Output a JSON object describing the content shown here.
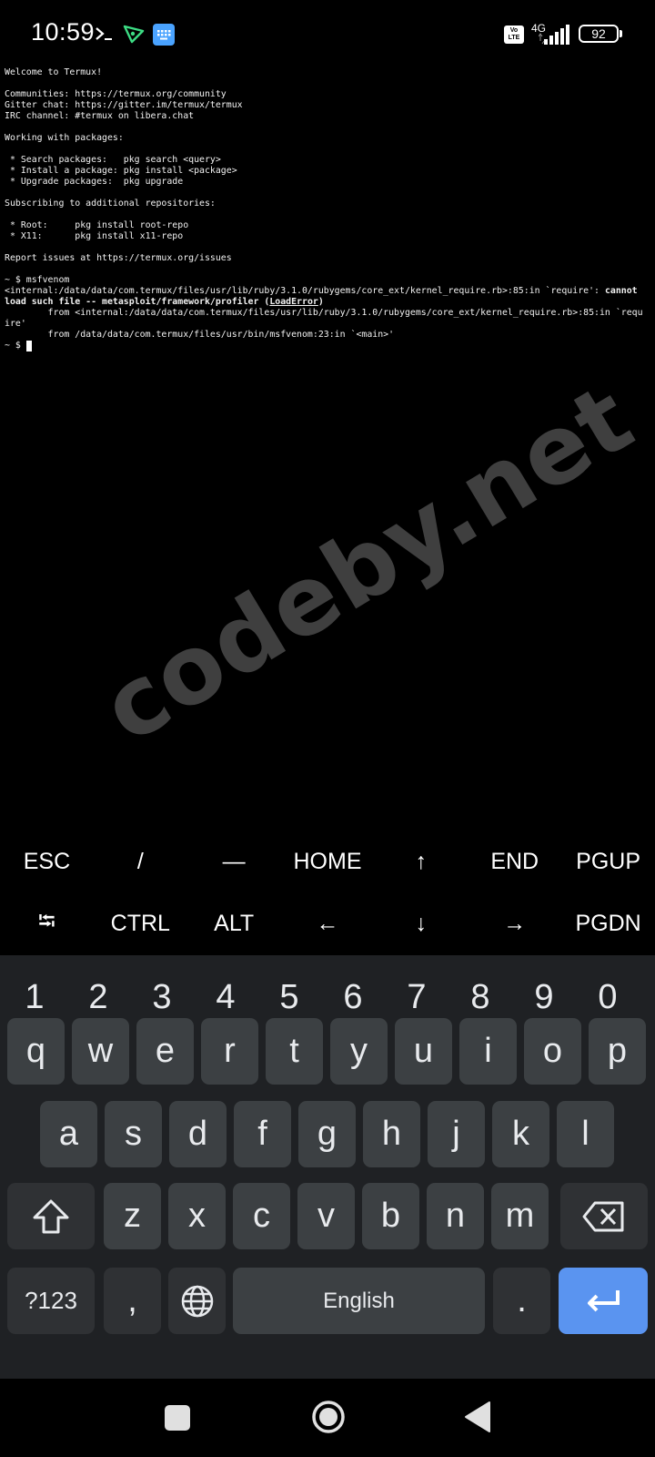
{
  "status_bar": {
    "time": "10:59",
    "prompt_glyph": ">_",
    "volte": "Vo\nLTE",
    "network_type": "4G",
    "battery": "92"
  },
  "terminal": {
    "lines": [
      "Welcome to Termux!",
      "",
      "Communities: https://termux.org/community",
      "Gitter chat: https://gitter.im/termux/termux",
      "IRC channel: #termux on libera.chat",
      "",
      "Working with packages:",
      "",
      " * Search packages:   pkg search <query>",
      " * Install a package: pkg install <package>",
      " * Upgrade packages:  pkg upgrade",
      "",
      "Subscribing to additional repositories:",
      "",
      " * Root:     pkg install root-repo",
      " * X11:      pkg install x11-repo",
      "",
      "Report issues at https://termux.org/issues",
      "",
      "~ $ msfvenom"
    ],
    "error_line_1": "<internal:/data/data/com.termux/files/usr/lib/ruby/3.1.0/rubygems/core_ext/kernel_require.rb>:85:in `require': ",
    "error_bold_1": "cannot",
    "error_bold_2": "load such file -- metasploit/framework/profiler (",
    "error_link": "LoadError",
    "error_bold_3": ")",
    "from_line_1": "        from <internal:/data/data/com.termux/files/usr/lib/ruby/3.1.0/rubygems/core_ext/kernel_require.rb>:85:in `requ",
    "from_line_1b": "ire'",
    "from_line_2": "        from /data/data/com.termux/files/usr/bin/msfvenom:23:in `<main>'",
    "prompt": "~ $ "
  },
  "watermark": "codeby.net",
  "extra_keys": {
    "row1": [
      "ESC",
      "/",
      "—",
      "HOME",
      "↑",
      "END",
      "PGUP"
    ],
    "row2": [
      "⭾",
      "CTRL",
      "ALT",
      "←",
      "↓",
      "→",
      "PGDN"
    ]
  },
  "keyboard": {
    "numbers": [
      "1",
      "2",
      "3",
      "4",
      "5",
      "6",
      "7",
      "8",
      "9",
      "0"
    ],
    "row1": [
      "q",
      "w",
      "e",
      "r",
      "t",
      "y",
      "u",
      "i",
      "o",
      "p"
    ],
    "row2": [
      "a",
      "s",
      "d",
      "f",
      "g",
      "h",
      "j",
      "k",
      "l"
    ],
    "row3": [
      "z",
      "x",
      "c",
      "v",
      "b",
      "n",
      "m"
    ],
    "symbols_label": "?123",
    "comma": ",",
    "space_label": "English",
    "period": "."
  },
  "colors": {
    "keyboard_bg": "#1f2124",
    "key_bg": "#3c4043",
    "enter_bg": "#5a94f0"
  }
}
